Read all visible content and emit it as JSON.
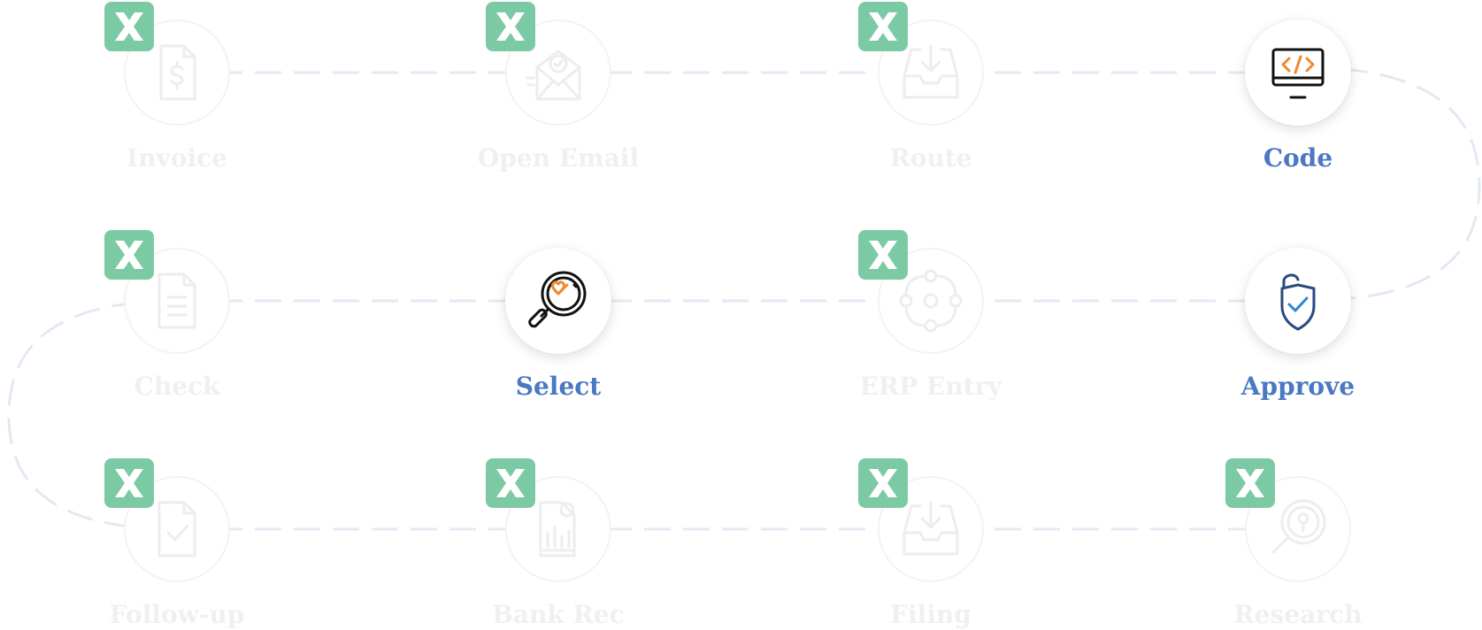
{
  "colors": {
    "connector": "#e3e9f3",
    "badge": "#7ccaa3",
    "active_label": "#4a78c2",
    "inactive_label": "#f0f0f2",
    "inactive_icon": "#ededef",
    "icon_dark": "#111111",
    "icon_accent": "#f08a2c",
    "icon_navy": "#2b4a80",
    "icon_blue": "#2f84d6"
  },
  "steps": [
    {
      "label": "Invoice",
      "state": "inactive",
      "icon": "invoice-icon",
      "badge": "x-badge-icon"
    },
    {
      "label": "Open Email",
      "state": "inactive",
      "icon": "open-email-icon",
      "badge": "x-badge-icon"
    },
    {
      "label": "Route",
      "state": "inactive",
      "icon": "inbox-download-icon",
      "badge": "x-badge-icon"
    },
    {
      "label": "Code",
      "state": "active",
      "icon": "code-monitor-icon",
      "badge": null
    },
    {
      "label": "Check",
      "state": "inactive",
      "icon": "document-icon",
      "badge": "x-badge-icon"
    },
    {
      "label": "Select",
      "state": "active",
      "icon": "magnifier-check-icon",
      "badge": null
    },
    {
      "label": "ERP Entry",
      "state": "inactive",
      "icon": "erp-network-icon",
      "badge": "x-badge-icon"
    },
    {
      "label": "Approve",
      "state": "active",
      "icon": "shield-check-icon",
      "badge": null
    },
    {
      "label": "Follow-up",
      "state": "inactive",
      "icon": "document-check-icon",
      "badge": "x-badge-icon"
    },
    {
      "label": "Bank Rec",
      "state": "inactive",
      "icon": "bank-statement-icon",
      "badge": "x-badge-icon"
    },
    {
      "label": "Filing",
      "state": "inactive",
      "icon": "inbox-download-icon",
      "badge": "x-badge-icon"
    },
    {
      "label": "Research",
      "state": "inactive",
      "icon": "research-icon",
      "badge": "x-badge-icon"
    }
  ]
}
